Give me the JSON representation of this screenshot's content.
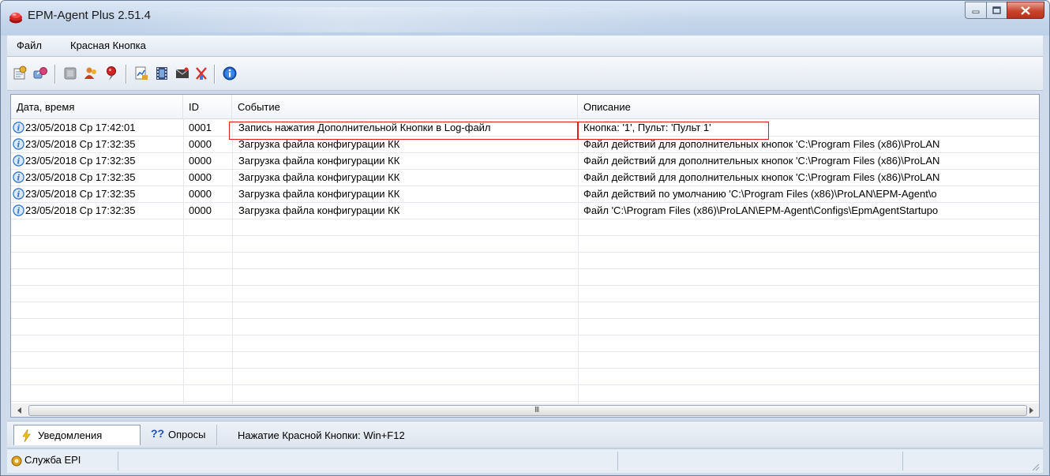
{
  "window": {
    "title": "EPM-Agent Plus 2.51.4",
    "controls": [
      "minimize",
      "maximize",
      "close"
    ]
  },
  "menu": [
    {
      "label": "Файл"
    },
    {
      "label": "Красная Кнопка"
    }
  ],
  "toolbar": {
    "icons": [
      "settings-icon",
      "connect-icon",
      "disabled-icon",
      "users-icon",
      "pin-icon",
      "report-icon",
      "film-icon",
      "message-icon",
      "clear-icon",
      "info-icon"
    ]
  },
  "table": {
    "columns": [
      "Дата, время",
      "ID",
      "Событие",
      "Описание"
    ],
    "rows": [
      {
        "datetime": "23/05/2018 Ср 17:42:01",
        "id": "0001",
        "event": "Запись нажатия Дополнительной Кнопки в Log-файл",
        "description": "Кнопка: '1', Пульт: 'Пульт 1'",
        "highlighted": true
      },
      {
        "datetime": "23/05/2018 Ср 17:32:35",
        "id": "0000",
        "event": "Загрузка файла конфигурации КК",
        "description": "Файл действий для дополнительных кнопок 'C:\\Program Files (x86)\\ProLAN",
        "highlighted": false
      },
      {
        "datetime": "23/05/2018 Ср 17:32:35",
        "id": "0000",
        "event": "Загрузка файла конфигурации КК",
        "description": "Файл действий для дополнительных кнопок 'C:\\Program Files (x86)\\ProLAN",
        "highlighted": false
      },
      {
        "datetime": "23/05/2018 Ср 17:32:35",
        "id": "0000",
        "event": "Загрузка файла конфигурации КК",
        "description": "Файл действий для дополнительных кнопок 'C:\\Program Files (x86)\\ProLAN",
        "highlighted": false
      },
      {
        "datetime": "23/05/2018 Ср 17:32:35",
        "id": "0000",
        "event": "Загрузка файла конфигурации КК",
        "description": "Файл действий по умолчанию 'C:\\Program Files (x86)\\ProLAN\\EPM-Agent\\o",
        "highlighted": false
      },
      {
        "datetime": "23/05/2018 Ср 17:32:35",
        "id": "0000",
        "event": "Загрузка файла конфигурации КК",
        "description": "Файл 'C:\\Program Files (x86)\\ProLAN\\EPM-Agent\\Configs\\EpmAgentStartupo",
        "highlighted": false
      }
    ]
  },
  "scrollbar": {
    "grip": "III"
  },
  "tabs": [
    {
      "label": "Уведомления",
      "icon": "lightning-icon",
      "active": true
    },
    {
      "label": "Опросы",
      "icon": "question-icon",
      "icon_text": "??",
      "active": false
    }
  ],
  "hotkey_text": "Нажатие Красной Кнопки: Win+F12",
  "status": {
    "text": "Служба EPI",
    "icon": "service-icon"
  },
  "colors": {
    "highlight_border": "#e02020",
    "close_button": "#c8452d",
    "info_icon": "#2f78d0"
  }
}
